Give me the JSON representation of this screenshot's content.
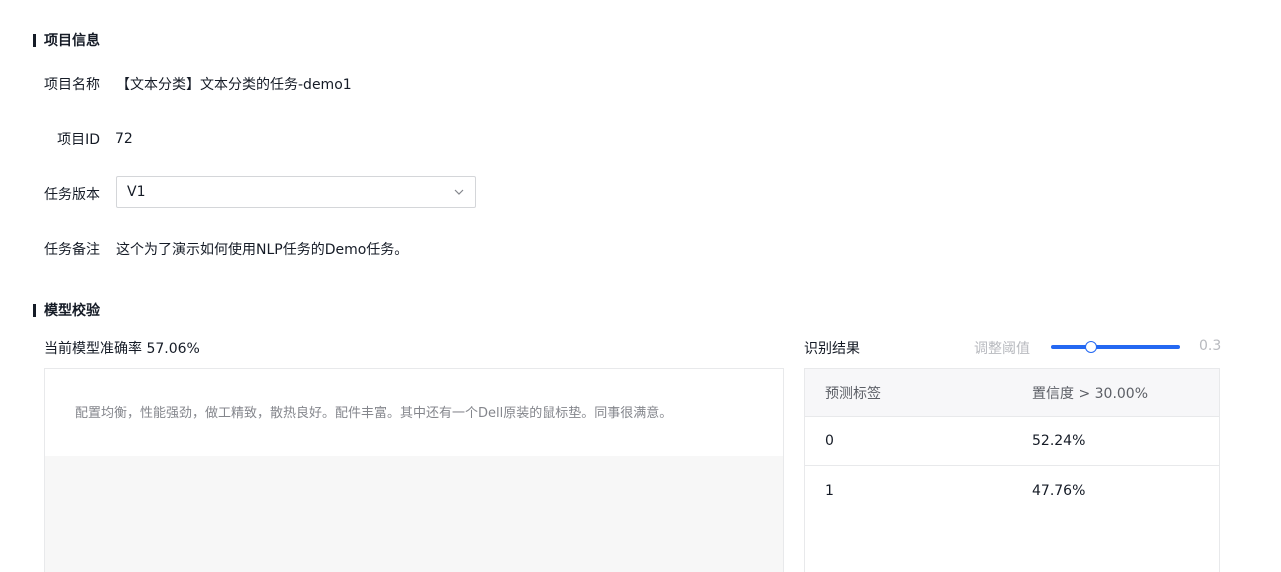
{
  "project_info": {
    "title": "项目信息",
    "name_label": "项目名称",
    "name_value": "【文本分类】文本分类的任务-demo1",
    "id_label": "项目ID",
    "id_value": "72",
    "version_label": "任务版本",
    "version_value": "V1",
    "note_label": "任务备注",
    "note_value": "这个为了演示如何使用NLP任务的Demo任务。"
  },
  "model_check": {
    "title": "模型校验",
    "accuracy_text": "当前模型准确率 57.06%",
    "input_text": "配置均衡，性能强劲，做工精致，散热良好。配件丰富。其中还有一个Dell原装的鼠标垫。同事很满意。",
    "result_title": "识别结果",
    "threshold_label": "调整阈值",
    "threshold_value": "0.3",
    "threshold_fraction": 0.3,
    "table": {
      "headers": [
        "预测标签",
        "置信度 > 30.00%"
      ],
      "rows": [
        [
          "0",
          "52.24%"
        ],
        [
          "1",
          "47.76%"
        ]
      ]
    }
  },
  "colors": {
    "accent": "#2468f2",
    "text": "#151b26",
    "muted": "#b8babf"
  }
}
